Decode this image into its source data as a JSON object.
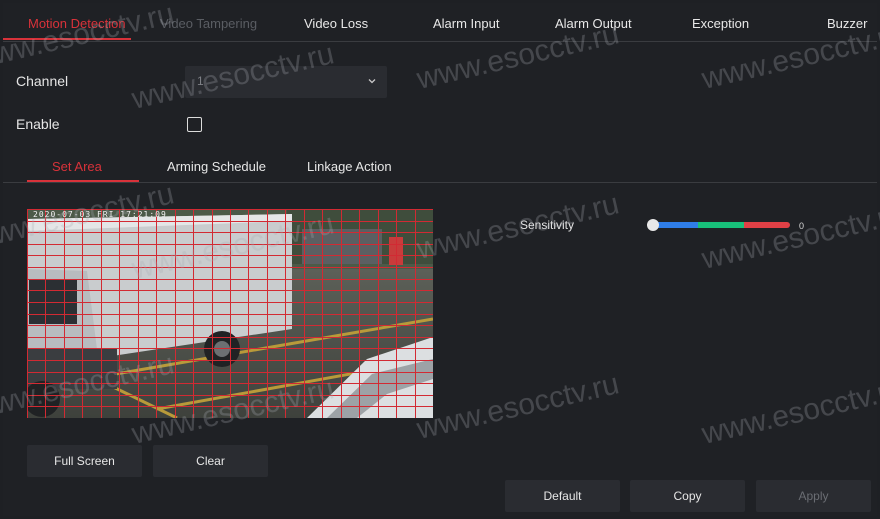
{
  "top_tabs": [
    {
      "label": "Motion Detection",
      "state": "active"
    },
    {
      "label": "Video Tampering",
      "state": "disabled"
    },
    {
      "label": "Video Loss",
      "state": "normal"
    },
    {
      "label": "Alarm Input",
      "state": "normal"
    },
    {
      "label": "Alarm Output",
      "state": "normal"
    },
    {
      "label": "Exception",
      "state": "normal"
    },
    {
      "label": "Buzzer",
      "state": "normal"
    }
  ],
  "form": {
    "channel_label": "Channel",
    "channel_value": "1",
    "enable_label": "Enable",
    "enable_checked": false
  },
  "sub_tabs": [
    {
      "label": "Set Area",
      "state": "active"
    },
    {
      "label": "Arming Schedule",
      "state": "normal"
    },
    {
      "label": "Linkage Action",
      "state": "normal"
    }
  ],
  "video": {
    "osd_text": "2020-07-03 FRI 17:21:09"
  },
  "sensitivity": {
    "label": "Sensitivity",
    "value": "0",
    "colors": [
      "#2f7de8",
      "#18c07a",
      "#e04046"
    ]
  },
  "buttons": {
    "full_screen": "Full Screen",
    "clear": "Clear",
    "default": "Default",
    "copy": "Copy",
    "apply": "Apply"
  },
  "watermark": "www.esocctv.ru",
  "colors": {
    "accent": "#d8323a",
    "background": "#1f2125",
    "panel": "#2a2c31"
  }
}
